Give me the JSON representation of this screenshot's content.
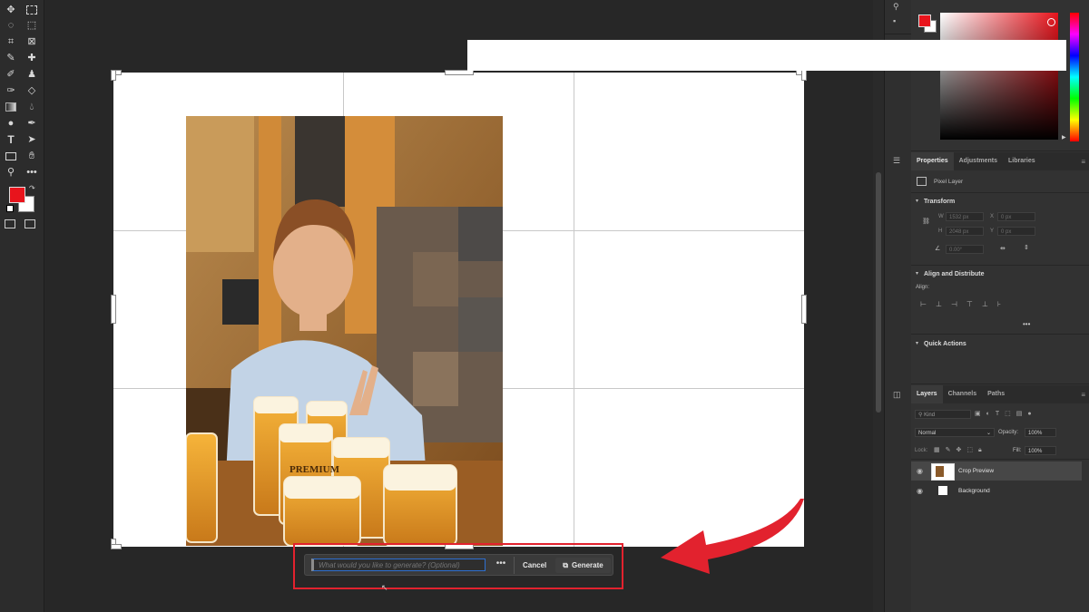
{
  "colors": {
    "accent_red": "#e2222e",
    "foreground_swatch": "#e8141c",
    "background_swatch": "#ffffff",
    "panel_bg": "#323232",
    "canvas_bg": "#272727"
  },
  "toolbar": {
    "tools": [
      "move-icon",
      "marquee-icon",
      "lasso-icon",
      "object-select-icon",
      "crop-icon",
      "frame-icon",
      "eyedropper-icon",
      "healing-brush-icon",
      "brush-icon",
      "clone-stamp-icon",
      "history-brush-icon",
      "eraser-icon",
      "gradient-icon",
      "blur-icon",
      "dodge-icon",
      "pen-icon",
      "type-icon",
      "path-select-icon",
      "rectangle-icon",
      "hand-icon",
      "zoom-icon",
      "more-tools-icon"
    ],
    "type_tool_glyph": "T"
  },
  "properties_panel": {
    "tabs": [
      "Properties",
      "Adjustments",
      "Libraries"
    ],
    "active_tab": "Properties",
    "layer_kind": "Pixel Layer",
    "transform_title": "Transform",
    "w_label": "W",
    "w_value": "1532 px",
    "h_label": "H",
    "h_value": "2048 px",
    "x_label": "X",
    "x_value": "0 px",
    "y_label": "Y",
    "y_value": "0 px",
    "angle_value": "0.00°",
    "align_title": "Align and Distribute",
    "align_label": "Align:",
    "quick_actions_title": "Quick Actions"
  },
  "layers_panel": {
    "tabs": [
      "Layers",
      "Channels",
      "Paths"
    ],
    "active_tab": "Layers",
    "kind_placeholder": "Kind",
    "blend_mode": "Normal",
    "opacity_label": "Opacity:",
    "opacity_value": "100%",
    "lock_label": "Lock:",
    "fill_label": "Fill:",
    "fill_value": "100%",
    "layers": [
      {
        "name": "Crop Preview",
        "selected": true
      },
      {
        "name": "Background",
        "selected": false
      }
    ]
  },
  "generative_bar": {
    "placeholder": "What would you like to generate? (Optional)",
    "more_label": "•••",
    "cancel_label": "Cancel",
    "generate_label": "Generate"
  },
  "photo": {
    "description_icon": "photo-of-man-with-beers",
    "mug_label": "PREMIUM"
  }
}
